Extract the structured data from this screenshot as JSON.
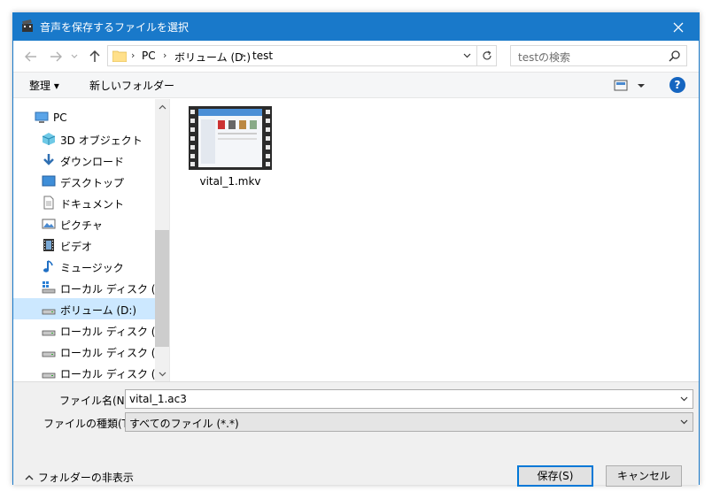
{
  "window": {
    "title": "音声を保存するファイルを選択"
  },
  "nav": {
    "path": [
      "PC",
      "ボリューム (D:)",
      "test"
    ],
    "search_placeholder": "testの検索"
  },
  "commands": {
    "organize": "整理 ▾",
    "new_folder": "新しいフォルダー"
  },
  "sidebar": {
    "items": [
      {
        "label": "PC",
        "icon": "pc-icon"
      },
      {
        "label": "3D オブジェクト",
        "icon": "3d-objects-icon"
      },
      {
        "label": "ダウンロード",
        "icon": "download-icon"
      },
      {
        "label": "デスクトップ",
        "icon": "desktop-icon"
      },
      {
        "label": "ドキュメント",
        "icon": "document-icon"
      },
      {
        "label": "ピクチャ",
        "icon": "pictures-icon"
      },
      {
        "label": "ビデオ",
        "icon": "video-icon"
      },
      {
        "label": "ミュージック",
        "icon": "music-icon"
      },
      {
        "label": "ローカル ディスク (C:)",
        "icon": "system-drive-icon"
      },
      {
        "label": "ボリューム (D:)",
        "icon": "drive-icon"
      },
      {
        "label": "ローカル ディスク (E:)",
        "icon": "drive-icon"
      },
      {
        "label": "ローカル ディスク (F:)",
        "icon": "drive-icon"
      },
      {
        "label": "ローカル ディスク (G:)",
        "icon": "drive-icon"
      }
    ],
    "selected_index": 9
  },
  "files": [
    {
      "name": "vital_1.mkv",
      "icon": "video-thumbnail-icon"
    }
  ],
  "form": {
    "filename_label": "ファイル名(N):",
    "filename_value": "vital_1.ac3",
    "filetype_label": "ファイルの種類(T):",
    "filetype_value": "すべてのファイル (*.*)",
    "hide_folders": "フォルダーの非表示",
    "save": "保存(S)",
    "cancel": "キャンセル"
  },
  "colors": {
    "titlebar": "#1979ca",
    "selection": "#cce8ff",
    "accent": "#0078d7"
  }
}
